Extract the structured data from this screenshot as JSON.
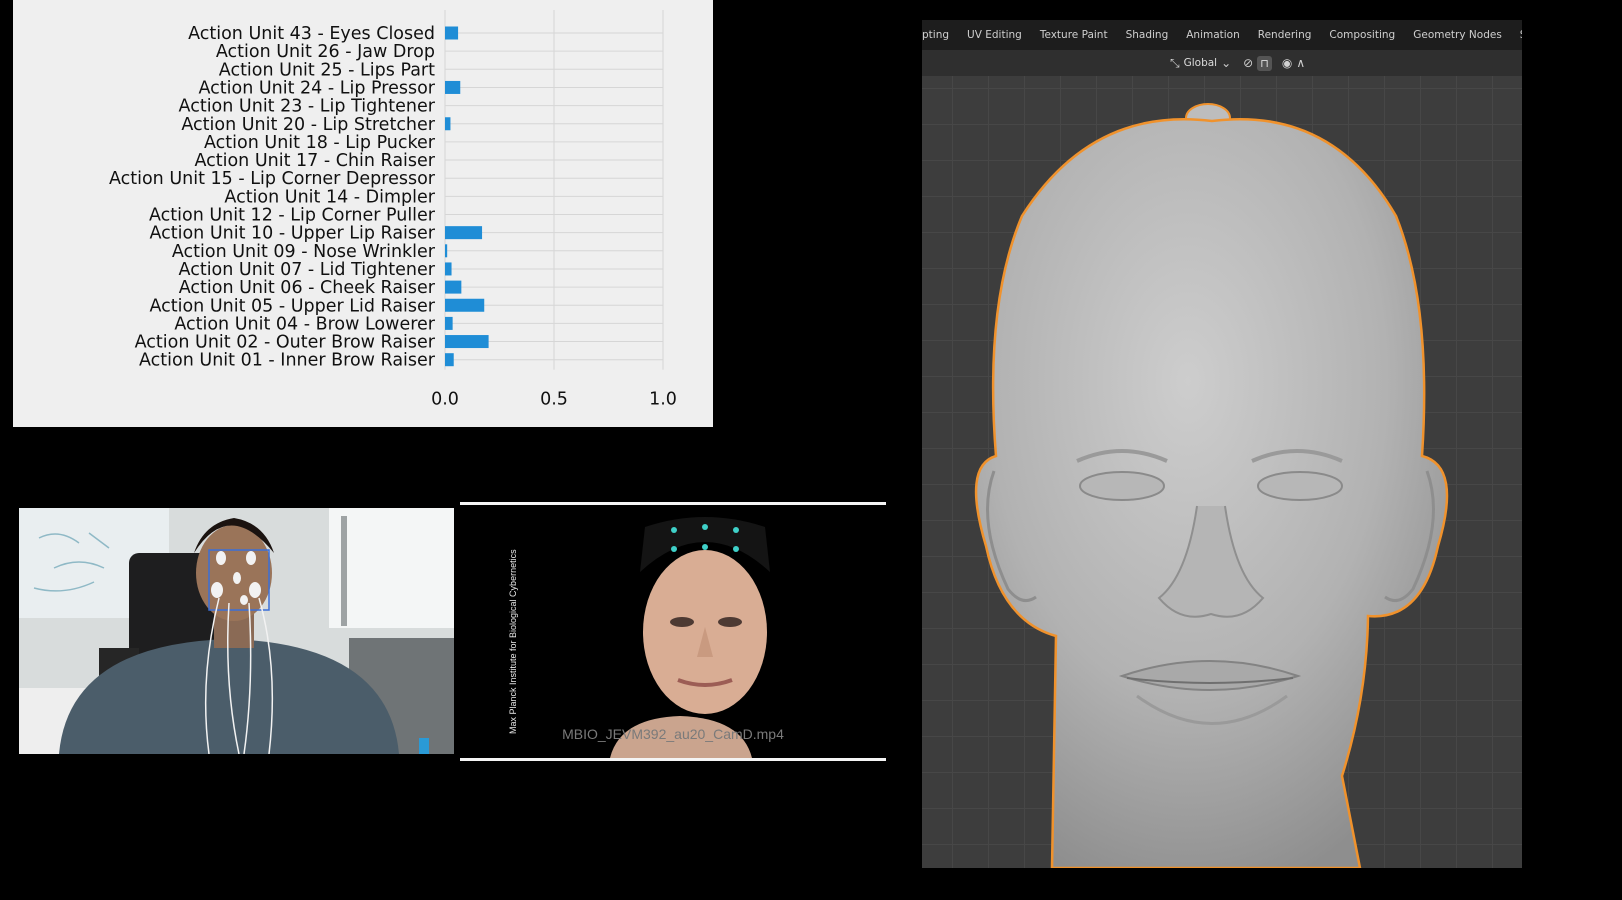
{
  "chart_data": {
    "type": "bar",
    "orientation": "horizontal",
    "categories": [
      "Action Unit 43 - Eyes Closed",
      "Action Unit 26 - Jaw Drop",
      "Action Unit 25 - Lips Part",
      "Action Unit 24 - Lip Pressor",
      "Action Unit 23 - Lip Tightener",
      "Action Unit 20 - Lip Stretcher",
      "Action Unit 18 - Lip Pucker",
      "Action Unit 17 - Chin Raiser",
      "Action Unit 15 - Lip Corner Depressor",
      "Action Unit 14 - Dimpler",
      "Action Unit 12 - Lip Corner Puller",
      "Action Unit 10 - Upper Lip Raiser",
      "Action Unit 09 - Nose Wrinkler",
      "Action Unit 07 - Lid Tightener",
      "Action Unit 06 - Cheek Raiser",
      "Action Unit 05 - Upper Lid Raiser",
      "Action Unit 04 - Brow Lowerer",
      "Action Unit 02 - Outer Brow Raiser",
      "Action Unit 01 - Inner Brow Raiser"
    ],
    "values": [
      0.06,
      0.0,
      0.0,
      0.07,
      0.0,
      0.025,
      0.0,
      0.0,
      0.0,
      0.0,
      0.0,
      0.17,
      0.01,
      0.03,
      0.075,
      0.18,
      0.035,
      0.2,
      0.04
    ],
    "xlim": [
      0.0,
      1.0
    ],
    "xticks": [
      "0.0",
      "0.5",
      "1.0"
    ],
    "grid": true,
    "bar_color": "#1f8dd6",
    "title": "",
    "xlabel": "",
    "ylabel": ""
  },
  "stimulus": {
    "caption": "MBIO_JEVM392_au20_CamD.mp4",
    "credit": "Max Planck Institute for Biological Cybernetics"
  },
  "blender": {
    "workspace_tabs": [
      "pting",
      "UV Editing",
      "Texture Paint",
      "Shading",
      "Animation",
      "Rendering",
      "Compositing",
      "Geometry Nodes",
      "Scripting",
      "+"
    ],
    "transform_orientation": "Global",
    "selection_outline_color": "#f0922c",
    "icons": [
      "transform-orientation-icon",
      "chevron-down-icon",
      "pivot-icon",
      "snap-icon",
      "proportional-edit-icon",
      "falloff-icon"
    ]
  }
}
